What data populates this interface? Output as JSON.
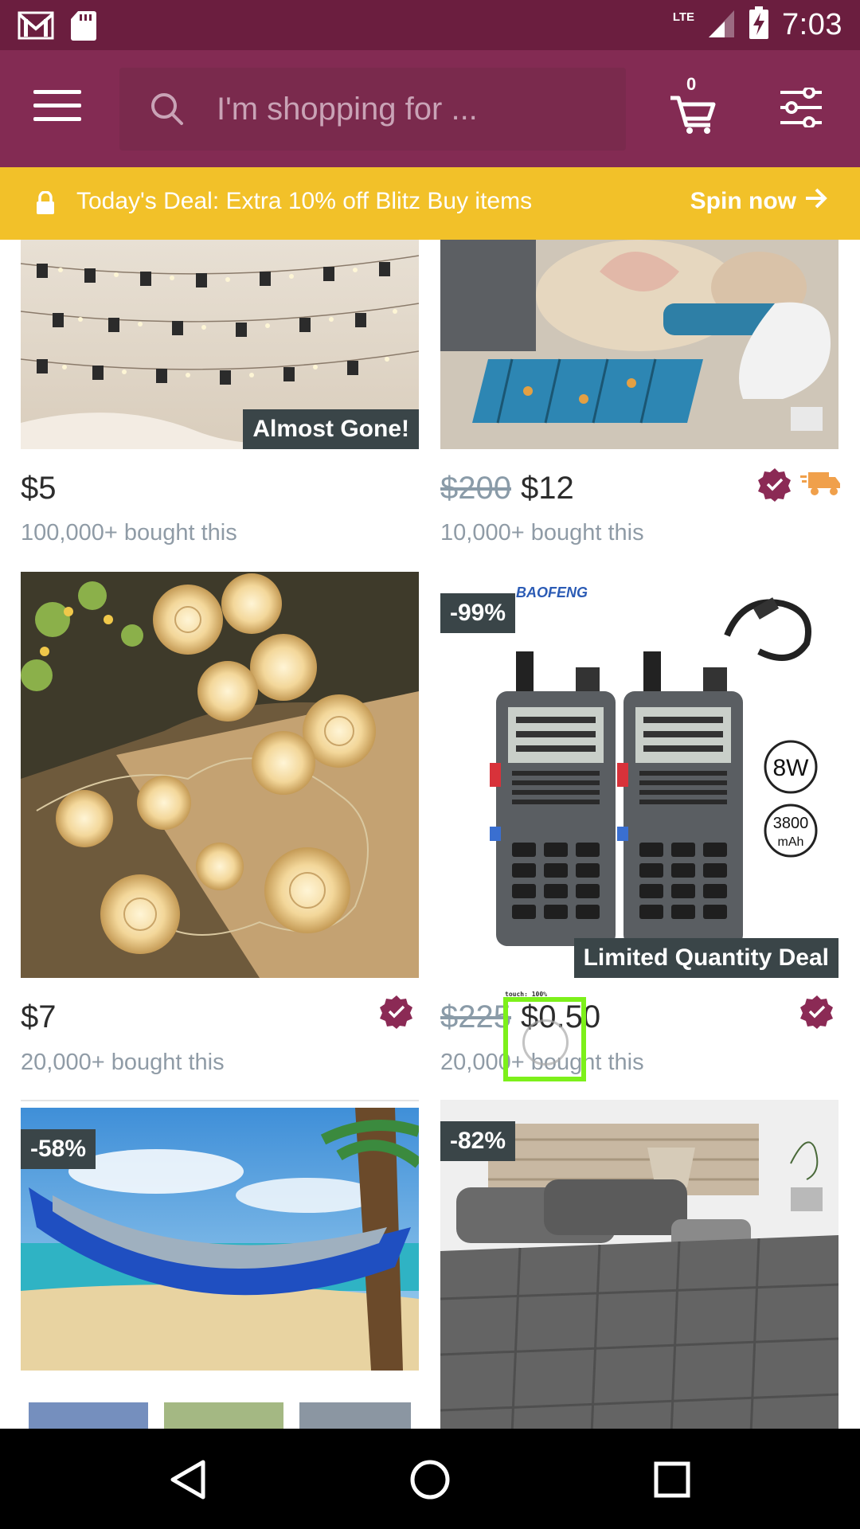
{
  "status_bar": {
    "network": "LTE",
    "time": "7:03",
    "icons": [
      "gmail-icon",
      "sd-card-icon",
      "signal-icon",
      "battery-charging-icon"
    ]
  },
  "app_bar": {
    "search_placeholder": "I'm shopping for ...",
    "cart_count": "0",
    "icons": [
      "menu-icon",
      "search-icon",
      "cart-icon",
      "filter-icon"
    ]
  },
  "deal_banner": {
    "text": "Today's Deal: Extra 10% off Blitz Buy items",
    "cta": "Spin now",
    "icons": [
      "lock-icon",
      "arrow-right-icon"
    ]
  },
  "products": [
    {
      "price": "$5",
      "original_price": "",
      "bought": "100,000+ bought this",
      "overlay": "Almost Gone!",
      "discount": ""
    },
    {
      "price": "$12",
      "original_price": "$200",
      "bought": "10,000+ bought this",
      "overlay": "",
      "discount": ""
    },
    {
      "price": "$7",
      "original_price": "",
      "bought": "20,000+ bought this",
      "overlay": "",
      "discount": ""
    },
    {
      "price": "$0.50",
      "original_price": "$225",
      "bought": "20,000+ bought this",
      "overlay": "Limited Quantity Deal",
      "discount": "-99%",
      "image_text": [
        "8W",
        "3800",
        "mAh",
        "BAOFENG"
      ]
    },
    {
      "price": "",
      "original_price": "",
      "bought": "",
      "overlay": "",
      "discount": "-58%"
    },
    {
      "price": "",
      "original_price": "",
      "bought": "",
      "overlay": "",
      "discount": "-82%"
    }
  ],
  "touch_indicator": {
    "label": "touch: 100%"
  },
  "colors": {
    "status_bar": "#6b1e3f",
    "app_bar": "#832b53",
    "deal_banner": "#f2c129",
    "verified_badge": "#8b2a55",
    "shipping_truck": "#f0a04b",
    "touch_box": "#7df01a"
  }
}
